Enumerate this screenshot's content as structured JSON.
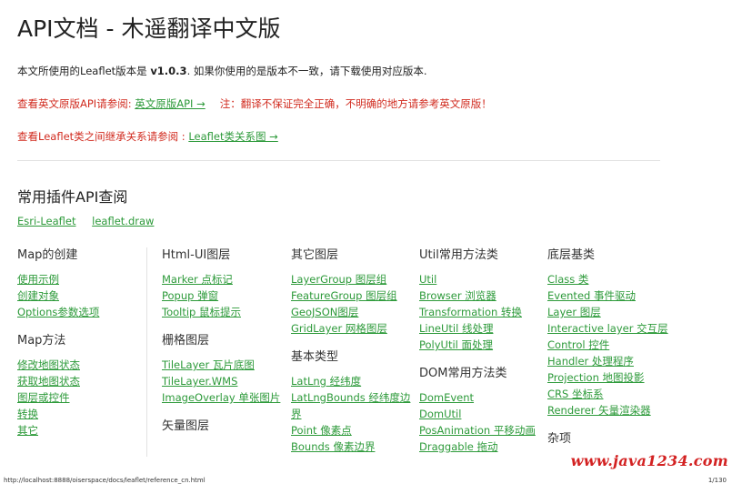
{
  "title": "API文档 - 木遥翻译中文版",
  "version_line": {
    "before": "本文所使用的Leaflet版本是 ",
    "version": "v1.0.3",
    "after": ". 如果你使用的是版本不一致，请下载使用对应版本."
  },
  "english_line": {
    "prefix": "查看英文原版API请参阅: ",
    "link": "英文原版API →",
    "note": "注：翻译不保证完全正确，不明确的地方请参考英文原版！"
  },
  "class_line": {
    "prefix": "查看Leaflet类之间继承关系请参阅 : ",
    "link": "Leaflet类关系图 →"
  },
  "plugins": {
    "heading": "常用插件API查阅",
    "links": [
      "Esri-Leaflet",
      "leaflet.draw"
    ]
  },
  "columns": [
    {
      "sections": [
        {
          "heading": "Map的创建",
          "items": [
            "使用示例",
            "创建对象",
            "Options参数选项"
          ]
        },
        {
          "heading": "Map方法",
          "items": [
            "修改地图状态",
            "获取地图状态",
            "图层或控件",
            "转换",
            "其它"
          ]
        }
      ]
    },
    {
      "sections": [
        {
          "heading": "Html-UI图层",
          "items": [
            "Marker 点标记",
            "Popup 弹窗",
            "Tooltip 鼠标提示"
          ]
        },
        {
          "heading": "栅格图层",
          "items": [
            "TileLayer 瓦片底图",
            "TileLayer.WMS",
            "ImageOverlay 单张图片"
          ]
        },
        {
          "heading": "矢量图层",
          "items": []
        }
      ]
    },
    {
      "sections": [
        {
          "heading": "其它图层",
          "items": [
            "LayerGroup 图层组",
            "FeatureGroup 图层组",
            "GeoJSON图层",
            "GridLayer 网格图层"
          ]
        },
        {
          "heading": "基本类型",
          "items": [
            "LatLng 经纬度",
            "LatLngBounds 经纬度边界",
            "Point 像素点",
            "Bounds 像素边界"
          ]
        }
      ]
    },
    {
      "sections": [
        {
          "heading": "Util常用方法类",
          "items": [
            "Util",
            "Browser 浏览器",
            "Transformation 转换",
            "LineUtil 线处理",
            "PolyUtil 面处理"
          ]
        },
        {
          "heading": "DOM常用方法类",
          "items": [
            "DomEvent",
            "DomUtil",
            "PosAnimation 平移动画",
            "Draggable 拖动"
          ]
        }
      ]
    },
    {
      "sections": [
        {
          "heading": "底层基类",
          "items": [
            "Class 类",
            "Evented 事件驱动",
            "Layer 图层",
            "Interactive layer 交互层",
            "Control 控件",
            "Handler 处理程序",
            "Projection 地图投影",
            "CRS 坐标系",
            "Renderer 矢量渲染器"
          ]
        },
        {
          "heading": "杂项",
          "items": []
        }
      ]
    }
  ],
  "status_url": "http://localhost:8888/oiserspace/docs/leaflet/reference_cn.html",
  "pager": "1/130",
  "watermark": "www.java1234.com",
  "colors": {
    "link": "#2d9a3a",
    "red": "#d12b1f",
    "watermark": "#d32222"
  }
}
